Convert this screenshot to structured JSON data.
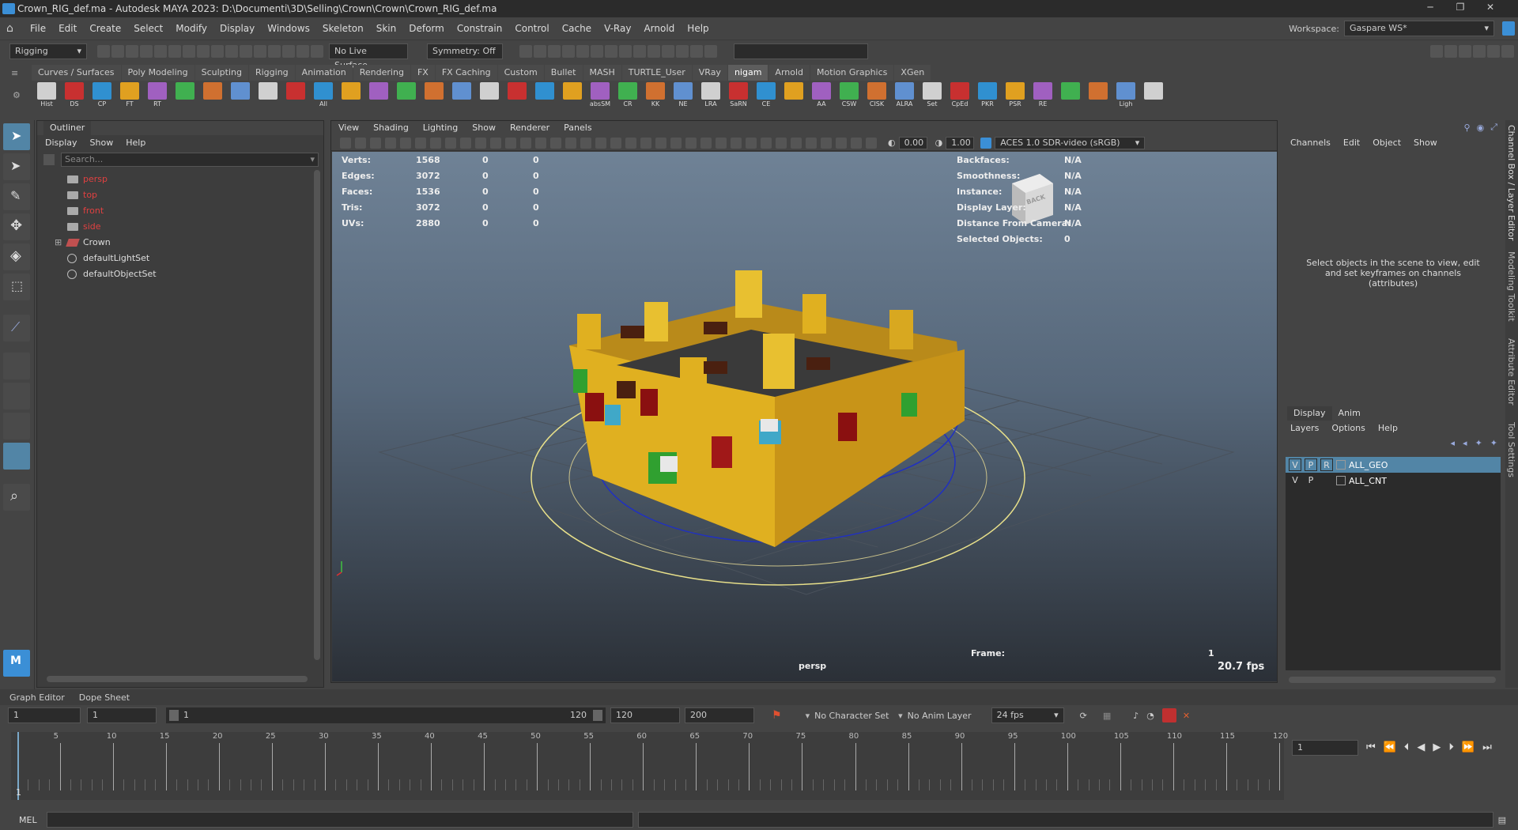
{
  "window": {
    "title": "Crown_RIG_def.ma - Autodesk MAYA 2023: D:\\Documenti\\3D\\Selling\\Crown\\Crown\\Crown_RIG_def.ma"
  },
  "menu": [
    "File",
    "Edit",
    "Create",
    "Select",
    "Modify",
    "Display",
    "Windows",
    "Skeleton",
    "Skin",
    "Deform",
    "Constrain",
    "Control",
    "Cache",
    "V-Ray",
    "Arnold",
    "Help"
  ],
  "workspace": {
    "label": "Workspace:",
    "value": "Gaspare WS*"
  },
  "statusline": {
    "mode": "Rigging",
    "live_surface": "No Live Surface",
    "symmetry": "Symmetry: Off"
  },
  "shelf_tabs": [
    "Curves / Surfaces",
    "Poly Modeling",
    "Sculpting",
    "Rigging",
    "Animation",
    "Rendering",
    "FX",
    "FX Caching",
    "Custom",
    "Bullet",
    "MASH",
    "TURTLE_User",
    "VRay",
    "nigam",
    "Arnold",
    "Motion Graphics",
    "XGen"
  ],
  "shelf_active": "nigam",
  "shelf_buttons": [
    "Hist",
    "DS",
    "CP",
    "FT",
    "RT",
    "",
    "",
    "",
    "",
    "",
    "All",
    "",
    "",
    "",
    "",
    "",
    "",
    "",
    "",
    "",
    "absSM",
    "CR",
    "KK",
    "NE",
    "LRA",
    "SaRN",
    "CE",
    "",
    "AA",
    "CSW",
    "CISK",
    "ALRA",
    "Set",
    "CpEd",
    "PKR",
    "PSR",
    "RE",
    "",
    "",
    "Ligh",
    ""
  ],
  "outliner": {
    "title": "Outliner",
    "menu": [
      "Display",
      "Show",
      "Help"
    ],
    "search_placeholder": "Search...",
    "items": [
      {
        "label": "persp",
        "type": "camera"
      },
      {
        "label": "top",
        "type": "camera"
      },
      {
        "label": "front",
        "type": "camera"
      },
      {
        "label": "side",
        "type": "camera"
      },
      {
        "label": "Crown",
        "type": "group"
      },
      {
        "label": "defaultLightSet",
        "type": "set"
      },
      {
        "label": "defaultObjectSet",
        "type": "set"
      }
    ]
  },
  "viewport": {
    "menu": [
      "View",
      "Shading",
      "Lighting",
      "Show",
      "Renderer",
      "Panels"
    ],
    "exposure": "0.00",
    "gamma": "1.00",
    "color_space": "ACES 1.0 SDR-video (sRGB)",
    "stats": [
      {
        "label": "Verts:",
        "a": "1568",
        "b": "0",
        "c": "0"
      },
      {
        "label": "Edges:",
        "a": "3072",
        "b": "0",
        "c": "0"
      },
      {
        "label": "Faces:",
        "a": "1536",
        "b": "0",
        "c": "0"
      },
      {
        "label": "Tris:",
        "a": "3072",
        "b": "0",
        "c": "0"
      },
      {
        "label": "UVs:",
        "a": "2880",
        "b": "0",
        "c": "0"
      }
    ],
    "info": [
      {
        "label": "Backfaces:",
        "value": "N/A"
      },
      {
        "label": "Smoothness:",
        "value": "N/A"
      },
      {
        "label": "Instance:",
        "value": "N/A"
      },
      {
        "label": "Display Layer:",
        "value": "N/A"
      },
      {
        "label": "Distance From Camera:",
        "value": "N/A"
      },
      {
        "label": "Selected Objects:",
        "value": "0"
      }
    ],
    "cube_label": "BACK",
    "camera": "persp",
    "frame_label": "Frame:",
    "frame": "1",
    "fps": "20.7 fps"
  },
  "channelbox": {
    "menu": [
      "Channels",
      "Edit",
      "Object",
      "Show"
    ],
    "empty_msg": "Select objects in the scene to view, edit and set keyframes on channels (attributes)",
    "layer_tabs": [
      "Display",
      "Anim"
    ],
    "layer_menu": [
      "Layers",
      "Options",
      "Help"
    ],
    "layers": [
      {
        "v": "V",
        "p": "P",
        "r": "R",
        "name": "ALL_GEO",
        "selected": true
      },
      {
        "v": "V",
        "p": "P",
        "r": "",
        "name": "ALL_CNT",
        "selected": false
      }
    ]
  },
  "side_tabs": [
    "Channel Box / Layer Editor",
    "Modeling Toolkit",
    "Attribute Editor",
    "Tool Settings"
  ],
  "bottom_tabs": [
    "Graph Editor",
    "Dope Sheet"
  ],
  "range": {
    "start": "1",
    "playback_start": "1",
    "range_left": "1",
    "range_right": "120",
    "playback_end": "120",
    "end": "200",
    "character_set": "No Character Set",
    "anim_layer": "No Anim Layer",
    "fps": "24 fps"
  },
  "timeline": {
    "ticks": [
      "5",
      "10",
      "15",
      "20",
      "25",
      "30",
      "35",
      "40",
      "45",
      "50",
      "55",
      "60",
      "65",
      "70",
      "75",
      "80",
      "85",
      "90",
      "95",
      "100",
      "105",
      "110",
      "115",
      "120"
    ],
    "current": "1",
    "current_field": "1"
  },
  "mel": {
    "label": "MEL"
  },
  "colors": {
    "accent": "#5285a6",
    "bg": "#444444",
    "panel": "#3d3d3d",
    "red_text": "#e04040",
    "gold": "#e0b020"
  }
}
